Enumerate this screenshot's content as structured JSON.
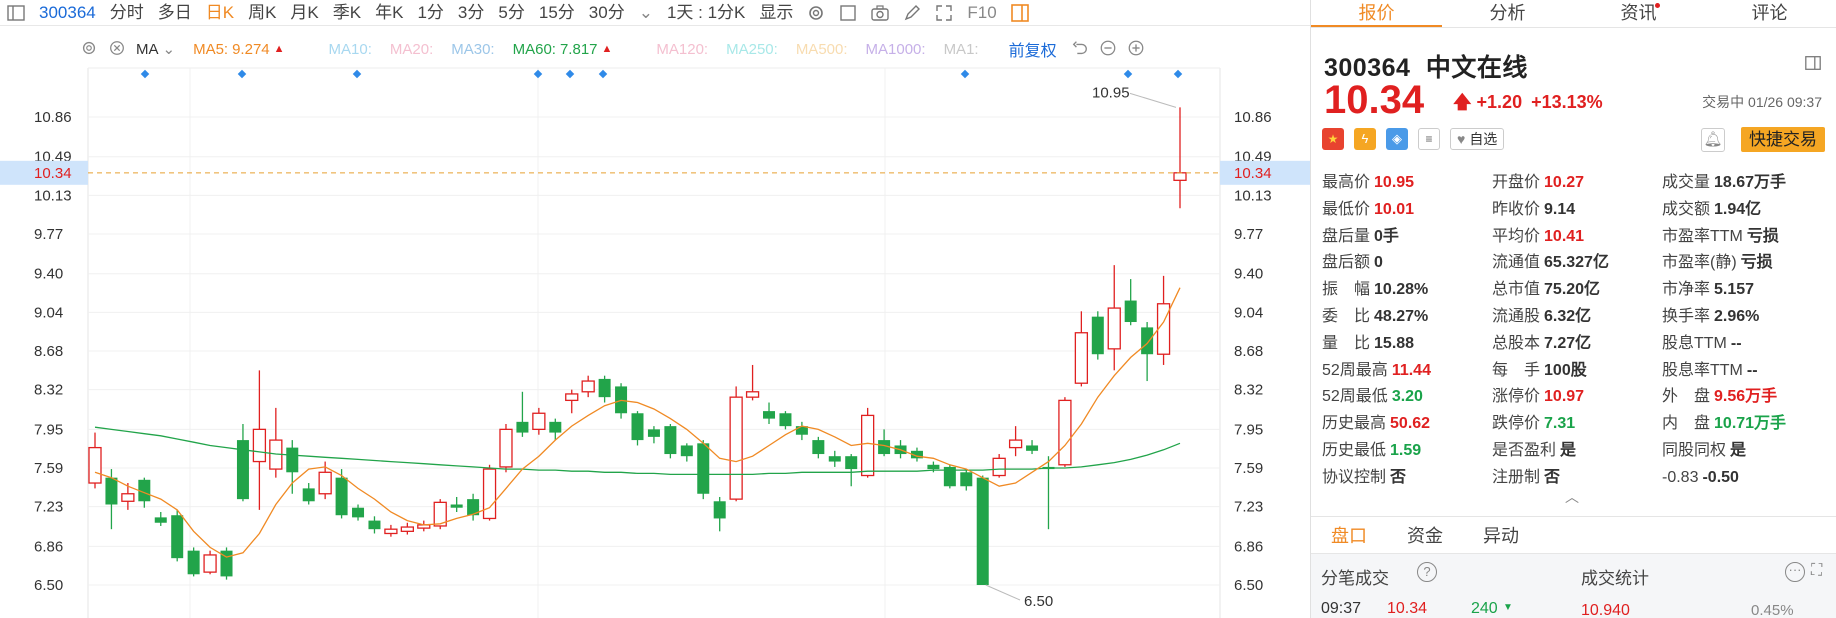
{
  "toolbar": {
    "items": [
      "300364",
      "分时",
      "多日",
      "日K",
      "周K",
      "月K",
      "季K",
      "年K",
      "1分",
      "3分",
      "5分",
      "15分",
      "30分",
      "1天 : 1分K",
      "显示",
      "F10"
    ],
    "active": "日K"
  },
  "ma_bar": {
    "select": "MA",
    "ma5_label": "MA5:",
    "ma5_value": "9.274",
    "ma10_label": "MA10:",
    "ma20_label": "MA20:",
    "ma30_label": "MA30:",
    "ma60_label": "MA60:",
    "ma60_value": "7.817",
    "ma120_label": "MA120:",
    "ma250_label": "MA250:",
    "ma500_label": "MA500:",
    "ma1000_label": "MA1000:",
    "ma1_label": "MA1:",
    "adjust": "前复权"
  },
  "right_tabs": [
    "报价",
    "分析",
    "资讯",
    "评论"
  ],
  "quote": {
    "code": "300364",
    "name": "中文在线",
    "price": "10.34",
    "change": "+1.20",
    "pct": "+13.13%",
    "status": "交易中 01/26 09:37",
    "watch_label": "自选",
    "quick_trade": "快捷交易"
  },
  "fields": [
    [
      {
        "l": "最高价",
        "v": "10.95",
        "c": "up"
      },
      {
        "l": "开盘价",
        "v": "10.27",
        "c": "up"
      },
      {
        "l": "成交量",
        "v": "18.67万手",
        "c": ""
      }
    ],
    [
      {
        "l": "最低价",
        "v": "10.01",
        "c": "up"
      },
      {
        "l": "昨收价",
        "v": "9.14",
        "c": ""
      },
      {
        "l": "成交额",
        "v": "1.94亿",
        "c": ""
      }
    ],
    [
      {
        "l": "盘后量",
        "v": "0手",
        "c": ""
      },
      {
        "l": "平均价",
        "v": "10.41",
        "c": "up"
      },
      {
        "l": "市盈率TTM",
        "v": "亏损",
        "c": ""
      }
    ],
    [
      {
        "l": "盘后额",
        "v": "0",
        "c": ""
      },
      {
        "l": "流通值",
        "v": "65.327亿",
        "c": ""
      },
      {
        "l": "市盈率(静)",
        "v": "亏损",
        "c": ""
      }
    ],
    [
      {
        "l": "振　幅",
        "v": "10.28%",
        "c": ""
      },
      {
        "l": "总市值",
        "v": "75.20亿",
        "c": ""
      },
      {
        "l": "市净率",
        "v": "5.157",
        "c": ""
      }
    ],
    [
      {
        "l": "委　比",
        "v": "48.27%",
        "c": ""
      },
      {
        "l": "流通股",
        "v": "6.32亿",
        "c": ""
      },
      {
        "l": "换手率",
        "v": "2.96%",
        "c": ""
      }
    ],
    [
      {
        "l": "量　比",
        "v": "15.88",
        "c": ""
      },
      {
        "l": "总股本",
        "v": "7.27亿",
        "c": ""
      },
      {
        "l": "股息TTM",
        "v": "--",
        "c": ""
      }
    ],
    [
      {
        "l": "52周最高",
        "v": "11.44",
        "c": "up"
      },
      {
        "l": "每　手",
        "v": "100股",
        "c": ""
      },
      {
        "l": "股息率TTM",
        "v": "--",
        "c": ""
      }
    ],
    [
      {
        "l": "52周最低",
        "v": "3.20",
        "c": "down"
      },
      {
        "l": "涨停价",
        "v": "10.97",
        "c": "up"
      },
      {
        "l": "外　盘",
        "v": "9.56万手",
        "c": "up"
      }
    ],
    [
      {
        "l": "历史最高",
        "v": "50.62",
        "c": "up"
      },
      {
        "l": "跌停价",
        "v": "7.31",
        "c": "down"
      },
      {
        "l": "内　盘",
        "v": "10.71万手",
        "c": "down"
      }
    ],
    [
      {
        "l": "历史最低",
        "v": "1.59",
        "c": "down"
      },
      {
        "l": "是否盈利",
        "v": "是",
        "c": ""
      },
      {
        "l": "同股同权",
        "v": "是",
        "c": ""
      }
    ],
    [
      {
        "l": "协议控制",
        "v": "否",
        "c": ""
      },
      {
        "l": "注册制",
        "v": "否",
        "c": ""
      },
      {
        "l": "-0.83",
        "v": "-0.50",
        "c": ""
      }
    ]
  ],
  "panel_tabs": [
    "盘口",
    "资金",
    "异动"
  ],
  "bottom": {
    "tick_title": "分笔成交",
    "stats_title": "成交统计",
    "tick_time": "09:37",
    "tick_price": "10.34",
    "tick_vol": "240",
    "stat_price": "10.940",
    "stat_pct": "0.45%"
  },
  "chart_data": {
    "type": "candlestick",
    "ylim": [
      6.4,
      11.1
    ],
    "yticks": [
      "10.86",
      "10.49",
      "10.13",
      "9.77",
      "9.40",
      "9.04",
      "8.68",
      "8.32",
      "7.95",
      "7.59",
      "7.23",
      "6.86",
      "6.50"
    ],
    "current_price_label": "10.34",
    "high_label": "10.95",
    "low_label": "6.50",
    "candles": [
      {
        "o": 7.45,
        "c": 7.78,
        "h": 7.92,
        "l": 7.4
      },
      {
        "o": 7.5,
        "c": 7.25,
        "h": 7.58,
        "l": 7.02
      },
      {
        "o": 7.28,
        "c": 7.35,
        "h": 7.45,
        "l": 7.2
      },
      {
        "o": 7.48,
        "c": 7.28,
        "h": 7.5,
        "l": 7.22
      },
      {
        "o": 7.13,
        "c": 7.08,
        "h": 7.18,
        "l": 7.05
      },
      {
        "o": 7.15,
        "c": 6.75,
        "h": 7.2,
        "l": 6.72
      },
      {
        "o": 6.82,
        "c": 6.6,
        "h": 6.85,
        "l": 6.58
      },
      {
        "o": 6.62,
        "c": 6.78,
        "h": 6.82,
        "l": 6.6
      },
      {
        "o": 6.82,
        "c": 6.58,
        "h": 6.85,
        "l": 6.55
      },
      {
        "o": 7.85,
        "c": 7.3,
        "h": 8.0,
        "l": 7.28
      },
      {
        "o": 7.65,
        "c": 7.95,
        "h": 8.5,
        "l": 7.2
      },
      {
        "o": 7.58,
        "c": 7.85,
        "h": 8.15,
        "l": 7.5
      },
      {
        "o": 7.78,
        "c": 7.55,
        "h": 7.85,
        "l": 7.35
      },
      {
        "o": 7.4,
        "c": 7.28,
        "h": 7.45,
        "l": 7.25
      },
      {
        "o": 7.35,
        "c": 7.55,
        "h": 7.65,
        "l": 7.3
      },
      {
        "o": 7.5,
        "c": 7.15,
        "h": 7.58,
        "l": 7.12
      },
      {
        "o": 7.22,
        "c": 7.13,
        "h": 7.25,
        "l": 7.1
      },
      {
        "o": 7.1,
        "c": 7.02,
        "h": 7.14,
        "l": 6.98
      },
      {
        "o": 6.98,
        "c": 7.02,
        "h": 7.06,
        "l": 6.95
      },
      {
        "o": 7.0,
        "c": 7.04,
        "h": 7.08,
        "l": 6.97
      },
      {
        "o": 7.03,
        "c": 7.06,
        "h": 7.1,
        "l": 7.0
      },
      {
        "o": 7.05,
        "c": 7.27,
        "h": 7.3,
        "l": 7.02
      },
      {
        "o": 7.25,
        "c": 7.22,
        "h": 7.32,
        "l": 7.18
      },
      {
        "o": 7.3,
        "c": 7.15,
        "h": 7.35,
        "l": 7.1
      },
      {
        "o": 7.12,
        "c": 7.58,
        "h": 7.62,
        "l": 7.1
      },
      {
        "o": 7.6,
        "c": 7.95,
        "h": 8.0,
        "l": 7.55
      },
      {
        "o": 8.02,
        "c": 7.92,
        "h": 8.3,
        "l": 7.88
      },
      {
        "o": 7.95,
        "c": 8.1,
        "h": 8.15,
        "l": 7.9
      },
      {
        "o": 8.02,
        "c": 7.92,
        "h": 8.05,
        "l": 7.85
      },
      {
        "o": 8.22,
        "c": 8.28,
        "h": 8.32,
        "l": 8.1
      },
      {
        "o": 8.3,
        "c": 8.4,
        "h": 8.45,
        "l": 8.25
      },
      {
        "o": 8.42,
        "c": 8.25,
        "h": 8.45,
        "l": 8.2
      },
      {
        "o": 8.35,
        "c": 8.1,
        "h": 8.38,
        "l": 8.05
      },
      {
        "o": 8.1,
        "c": 7.85,
        "h": 8.12,
        "l": 7.8
      },
      {
        "o": 7.95,
        "c": 7.88,
        "h": 7.98,
        "l": 7.82
      },
      {
        "o": 7.98,
        "c": 7.72,
        "h": 8.0,
        "l": 7.68
      },
      {
        "o": 7.8,
        "c": 7.7,
        "h": 7.82,
        "l": 7.65
      },
      {
        "o": 7.82,
        "c": 7.35,
        "h": 7.85,
        "l": 7.3
      },
      {
        "o": 7.28,
        "c": 7.12,
        "h": 7.32,
        "l": 7.0
      },
      {
        "o": 7.3,
        "c": 8.25,
        "h": 8.35,
        "l": 7.28
      },
      {
        "o": 8.25,
        "c": 8.3,
        "h": 8.55,
        "l": 8.22
      },
      {
        "o": 8.12,
        "c": 8.05,
        "h": 8.2,
        "l": 8.0
      },
      {
        "o": 8.1,
        "c": 7.98,
        "h": 8.12,
        "l": 7.95
      },
      {
        "o": 7.98,
        "c": 7.9,
        "h": 8.02,
        "l": 7.85
      },
      {
        "o": 7.85,
        "c": 7.72,
        "h": 7.88,
        "l": 7.68
      },
      {
        "o": 7.7,
        "c": 7.65,
        "h": 7.75,
        "l": 7.6
      },
      {
        "o": 7.7,
        "c": 7.58,
        "h": 7.72,
        "l": 7.42
      },
      {
        "o": 7.52,
        "c": 8.08,
        "h": 8.15,
        "l": 7.5
      },
      {
        "o": 7.85,
        "c": 7.72,
        "h": 7.95,
        "l": 7.7
      },
      {
        "o": 7.8,
        "c": 7.72,
        "h": 7.85,
        "l": 7.68
      },
      {
        "o": 7.75,
        "c": 7.68,
        "h": 7.78,
        "l": 7.65
      },
      {
        "o": 7.62,
        "c": 7.58,
        "h": 7.65,
        "l": 7.55
      },
      {
        "o": 7.6,
        "c": 7.42,
        "h": 7.62,
        "l": 7.4
      },
      {
        "o": 7.55,
        "c": 7.42,
        "h": 7.58,
        "l": 7.38
      },
      {
        "o": 7.5,
        "c": 6.5,
        "h": 7.52,
        "l": 6.5
      },
      {
        "o": 7.52,
        "c": 7.68,
        "h": 7.72,
        "l": 7.5
      },
      {
        "o": 7.78,
        "c": 7.85,
        "h": 7.98,
        "l": 7.7
      },
      {
        "o": 7.8,
        "c": 7.75,
        "h": 7.85,
        "l": 7.72
      },
      {
        "o": 7.6,
        "c": 7.58,
        "h": 7.7,
        "l": 7.02
      },
      {
        "o": 7.62,
        "c": 8.22,
        "h": 8.25,
        "l": 7.6
      },
      {
        "o": 8.38,
        "c": 8.85,
        "h": 9.05,
        "l": 8.35
      },
      {
        "o": 9.0,
        "c": 8.65,
        "h": 9.05,
        "l": 8.6
      },
      {
        "o": 8.7,
        "c": 9.08,
        "h": 9.48,
        "l": 8.5
      },
      {
        "o": 9.15,
        "c": 8.95,
        "h": 9.35,
        "l": 8.92
      },
      {
        "o": 8.9,
        "c": 8.65,
        "h": 8.95,
        "l": 8.4
      },
      {
        "o": 8.65,
        "c": 9.12,
        "h": 9.38,
        "l": 8.55
      },
      {
        "o": 10.27,
        "c": 10.34,
        "h": 10.95,
        "l": 10.01
      }
    ],
    "ma5": [
      7.55,
      7.5,
      7.42,
      7.36,
      7.3,
      7.2,
      7.0,
      6.85,
      6.76,
      6.8,
      6.98,
      7.25,
      7.45,
      7.58,
      7.6,
      7.52,
      7.4,
      7.3,
      7.18,
      7.1,
      7.06,
      7.07,
      7.12,
      7.16,
      7.22,
      7.4,
      7.58,
      7.7,
      7.85,
      7.98,
      8.08,
      8.17,
      8.22,
      8.2,
      8.14,
      8.05,
      7.95,
      7.82,
      7.68,
      7.65,
      7.7,
      7.8,
      7.9,
      7.98,
      7.95,
      7.88,
      7.8,
      7.82,
      7.8,
      7.76,
      7.7,
      7.68,
      7.62,
      7.58,
      7.5,
      7.42,
      7.45,
      7.55,
      7.65,
      7.8,
      8.0,
      8.25,
      8.45,
      8.62,
      8.75,
      8.95,
      9.27
    ],
    "ma60": [
      7.97,
      7.95,
      7.93,
      7.91,
      7.89,
      7.86,
      7.83,
      7.8,
      7.78,
      7.76,
      7.74,
      7.72,
      7.71,
      7.7,
      7.69,
      7.68,
      7.67,
      7.66,
      7.65,
      7.64,
      7.63,
      7.62,
      7.61,
      7.6,
      7.59,
      7.58,
      7.58,
      7.57,
      7.57,
      7.56,
      7.56,
      7.55,
      7.55,
      7.54,
      7.54,
      7.53,
      7.53,
      7.53,
      7.53,
      7.53,
      7.53,
      7.54,
      7.54,
      7.55,
      7.55,
      7.55,
      7.55,
      7.56,
      7.56,
      7.56,
      7.56,
      7.57,
      7.57,
      7.57,
      7.57,
      7.58,
      7.58,
      7.58,
      7.59,
      7.59,
      7.6,
      7.62,
      7.64,
      7.67,
      7.71,
      7.76,
      7.82
    ]
  }
}
